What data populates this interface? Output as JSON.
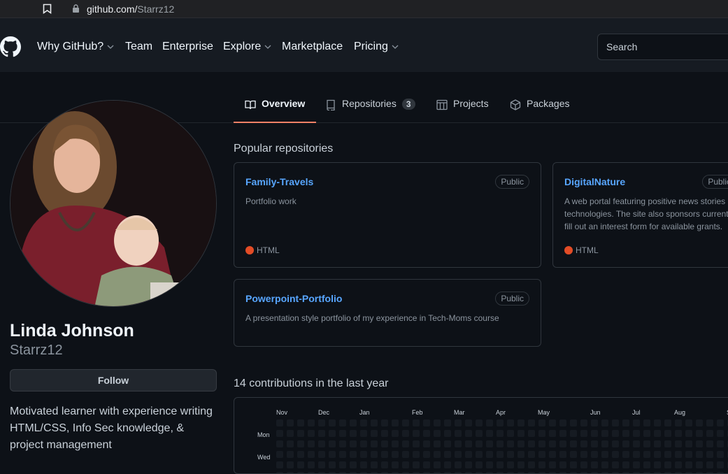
{
  "browser": {
    "url_host": "github.com/",
    "url_path": "Starrz12"
  },
  "header": {
    "nav": [
      {
        "label": "Why GitHub?",
        "dropdown": true
      },
      {
        "label": "Team",
        "dropdown": false
      },
      {
        "label": "Enterprise",
        "dropdown": false
      },
      {
        "label": "Explore",
        "dropdown": true
      },
      {
        "label": "Marketplace",
        "dropdown": false
      },
      {
        "label": "Pricing",
        "dropdown": true
      }
    ],
    "search_placeholder": "Search"
  },
  "tabs": [
    {
      "label": "Overview",
      "icon": "book-icon",
      "active": true
    },
    {
      "label": "Repositories",
      "icon": "repo-icon",
      "count": "3"
    },
    {
      "label": "Projects",
      "icon": "project-icon"
    },
    {
      "label": "Packages",
      "icon": "package-icon"
    }
  ],
  "profile": {
    "full_name": "Linda Johnson",
    "login": "Starrz12",
    "follow_label": "Follow",
    "bio": "Motivated learner with experience writing HTML/CSS, Info Sec knowledge, & project management"
  },
  "popular": {
    "title": "Popular repositories",
    "repos": [
      {
        "name": "Family-Travels",
        "badge": "Public",
        "description": "Portfolio work",
        "language": "HTML"
      },
      {
        "name": "DigitalNature",
        "badge": "Public",
        "description": "A web portal featuring positive news stories technologies. The site also sponsors current fill out an interest form for available grants.",
        "language": "HTML"
      },
      {
        "name": "Powerpoint-Portfolio",
        "badge": "Public",
        "description": "A presentation style portfolio of my experience in Tech-Moms course",
        "language": ""
      }
    ]
  },
  "contributions": {
    "title": "14 contributions in the last year",
    "months": [
      "Nov",
      "Dec",
      "Jan",
      "Feb",
      "Mar",
      "Apr",
      "May",
      "Jun",
      "Jul",
      "Aug",
      "S"
    ],
    "days": [
      "Mon",
      "Wed"
    ]
  },
  "colors": {
    "accent": "#f78166",
    "link": "#58a6ff",
    "html_lang": "#e34c26"
  }
}
